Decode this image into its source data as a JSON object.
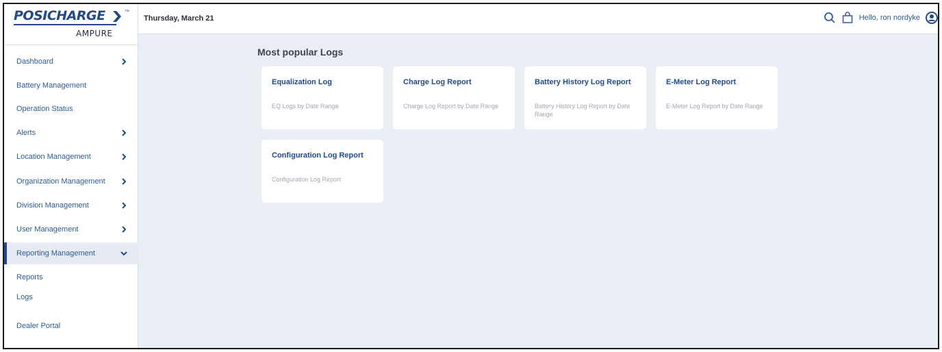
{
  "brand": {
    "name": "PosiCharge",
    "logo_main": "POSICHARGE",
    "logo_tm": "™",
    "logo_sub": "AMPURE"
  },
  "header": {
    "date": "Thursday, March 21",
    "greeting": "Hello, ron nordyke",
    "icons": [
      "search-icon",
      "shopping-bag-icon",
      "user-avatar-icon"
    ]
  },
  "sidebar": {
    "items": [
      {
        "label": "Dashboard",
        "has_children": true
      },
      {
        "label": "Battery Management",
        "has_children": false
      },
      {
        "label": "Operation Status",
        "has_children": false
      },
      {
        "label": "Alerts",
        "has_children": true
      },
      {
        "label": "Location Management",
        "has_children": true
      },
      {
        "label": "Organization Management",
        "has_children": true
      },
      {
        "label": "Division Management",
        "has_children": true
      },
      {
        "label": "User Management",
        "has_children": true
      },
      {
        "label": "Reporting Management",
        "has_children": true,
        "expanded": true,
        "active": true
      }
    ],
    "sub_items": [
      {
        "label": "Reports"
      },
      {
        "label": "Logs"
      }
    ],
    "footer_item": {
      "label": "Dealer Portal"
    }
  },
  "main": {
    "title": "Most popular Logs",
    "cards": [
      {
        "title": "Equalization Log",
        "description": "EQ Logs by Date Range"
      },
      {
        "title": "Charge Log Report",
        "description": "Charge Log Report by Date Range"
      },
      {
        "title": "Battery History Log Report",
        "description": "Battery History Log Report by Date Range"
      },
      {
        "title": "E-Meter Log Report",
        "description": "E-Meter Log Report by Date Range"
      },
      {
        "title": "Configuration Log Report",
        "description": "Configuration Log Report"
      }
    ]
  },
  "colors": {
    "brand_blue": "#1f4a8c",
    "link_blue": "#2d5b9a",
    "page_bg": "#e9edf4",
    "muted_text": "#a2a8b2"
  }
}
